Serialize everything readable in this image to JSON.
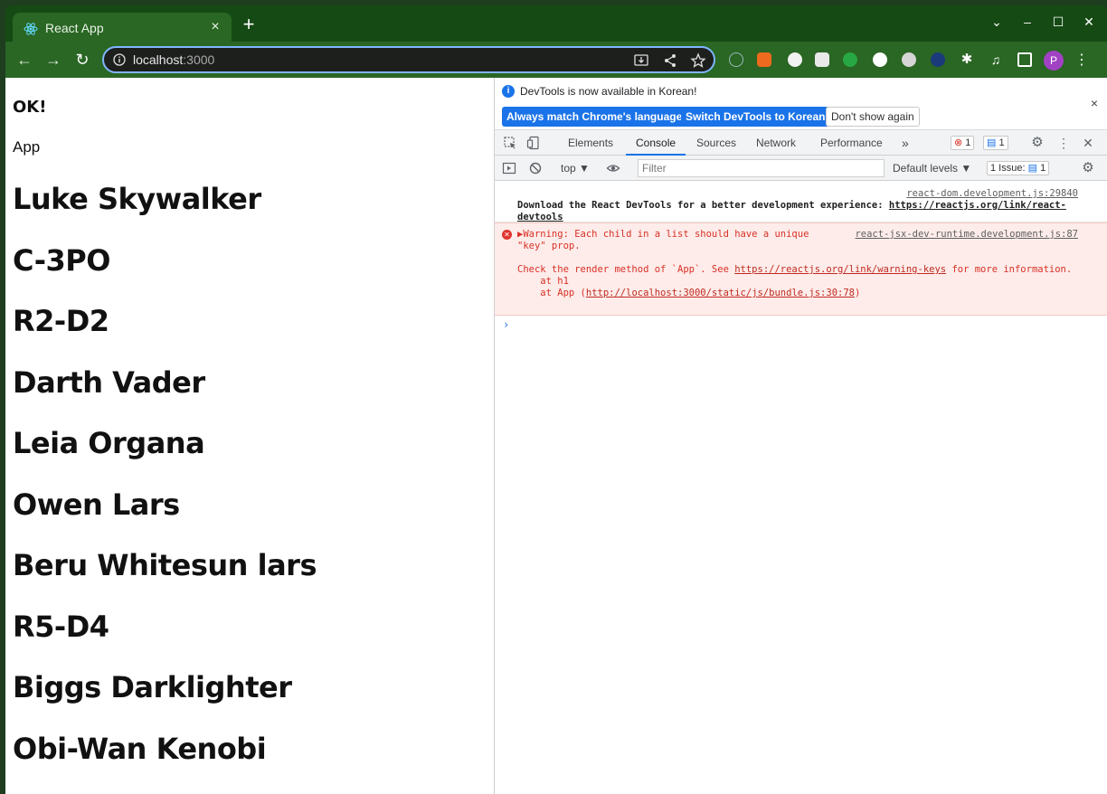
{
  "browser": {
    "tab_title": "React App",
    "tab_close": "×",
    "new_tab": "+",
    "url_host": "localhost",
    "url_port": ":3000",
    "window_controls": [
      "⌄",
      "–",
      "☐",
      "✕"
    ],
    "profile_initial": "P",
    "menu": "⋮"
  },
  "page": {
    "status": "OK!",
    "component": "App",
    "characters": [
      "Luke Skywalker",
      "C-3PO",
      "R2-D2",
      "Darth Vader",
      "Leia Organa",
      "Owen Lars",
      "Beru Whitesun lars",
      "R5-D4",
      "Biggs Darklighter",
      "Obi-Wan Kenobi"
    ]
  },
  "devtools": {
    "infobar": {
      "message": "DevTools is now available in Korean!",
      "btn_match": "Always match Chrome's language",
      "btn_switch": "Switch DevTools to Korean",
      "btn_dont_show": "Don't show again",
      "close": "×"
    },
    "tabs": [
      "Elements",
      "Console",
      "Sources",
      "Network",
      "Performance"
    ],
    "more_tabs": "»",
    "error_count": "1",
    "message_count": "1",
    "context": "top ▼",
    "filter_placeholder": "Filter",
    "levels": "Default levels ▼",
    "issues_label": "1 Issue:",
    "issues_count": "1",
    "messages": {
      "info_source": "react-dom.development.js:29840",
      "info_text": "Download the React DevTools for a better development experience: ",
      "info_link": "https://reactjs.org/link/react-devtools",
      "warn_head": "▶Warning: Each child in a list should have a unique \"key\" prop.",
      "warn_source": "react-jsx-dev-runtime.development.js:87",
      "warn_body_pre": "Check the render method of `App`. See ",
      "warn_body_link": "https://reactjs.org/link/warning-keys",
      "warn_body_post": " for more information.",
      "warn_at_h1": "    at h1",
      "warn_at_app_pre": "    at App (",
      "warn_at_app_link": "http://localhost:3000/static/js/bundle.js:30:78",
      "warn_at_app_post": ")"
    },
    "prompt": "›"
  },
  "colors": {
    "chrome_frame": "#164a14",
    "chrome_toolbar": "#2a6624",
    "accent_blue": "#1a73e8",
    "error_red": "#d93025",
    "error_bg": "#fdecea"
  }
}
